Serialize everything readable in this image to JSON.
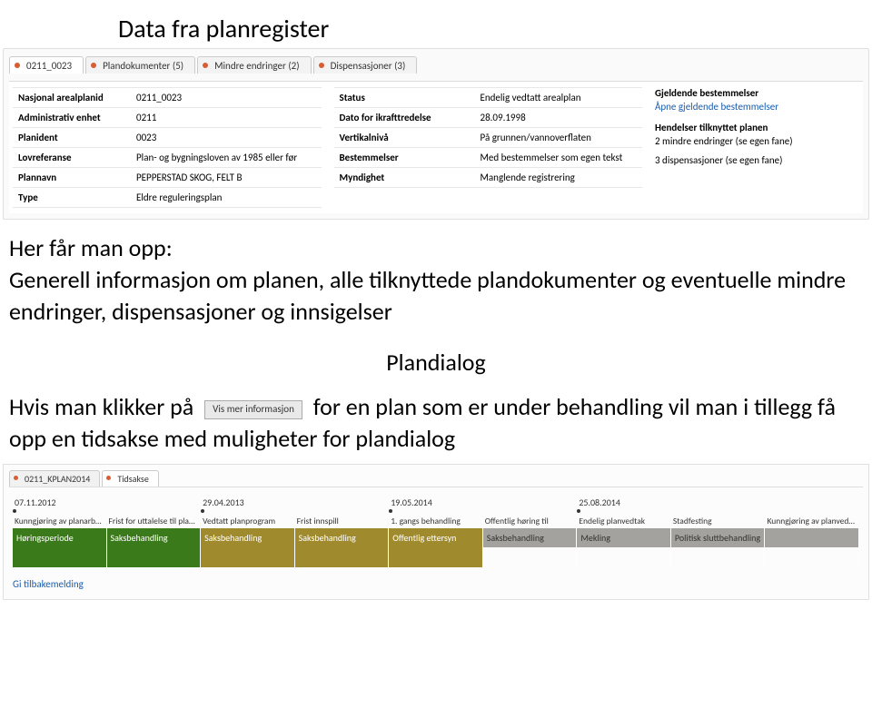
{
  "title": "Data fra planregister",
  "screenshot1": {
    "tabs": [
      {
        "label": "0211_0023",
        "active": true
      },
      {
        "label": "Plandokumenter (5)",
        "active": false
      },
      {
        "label": "Mindre endringer (2)",
        "active": false
      },
      {
        "label": "Dispensasjoner (3)",
        "active": false
      }
    ],
    "col1": [
      {
        "label": "Nasjonal arealplanid",
        "value": "0211_0023"
      },
      {
        "label": "Administrativ enhet",
        "value": "0211"
      },
      {
        "label": "Planident",
        "value": "0023"
      },
      {
        "label": "Lovreferanse",
        "value": "Plan- og bygningsloven av 1985 eller før"
      },
      {
        "label": "Plannavn",
        "value": "PEPPERSTAD SKOG, FELT B"
      },
      {
        "label": "Type",
        "value": "Eldre reguleringsplan"
      }
    ],
    "col2": [
      {
        "label": "Status",
        "value": "Endelig vedtatt arealplan"
      },
      {
        "label": "Dato for ikrafttredelse",
        "value": "28.09.1998"
      },
      {
        "label": "Vertikalnivå",
        "value": "På grunnen/vannoverflaten"
      },
      {
        "label": "Bestemmelser",
        "value": "Med bestemmelser som egen tekst"
      },
      {
        "label": "Myndighet",
        "value": "Manglende registrering"
      }
    ],
    "right": {
      "block1_title": "Gjeldende bestemmelser",
      "block1_link": "Åpne gjeldende bestemmelser",
      "block2_title": "Hendelser tilknyttet planen",
      "block2_line1": "2 mindre endringer (se egen fane)",
      "block2_line2": "3 dispensasjoner (se egen fane)"
    }
  },
  "body": {
    "line1": "Her får man opp:",
    "line2": "Generell informasjon om planen, alle tilknyttede plandokumenter og eventuelle mindre endringer, dispensasjoner og innsigelser",
    "subtitle": "Plandialog",
    "line3a": "Hvis man klikker på",
    "button_label": "Vis mer informasjon",
    "line3b": "for en plan som er under behandling vil man i tillegg få opp en tidsakse med muligheter for plandialog"
  },
  "screenshot2": {
    "tabs": [
      {
        "label": "0211_KPLAN2014",
        "active": false
      },
      {
        "label": "Tidsakse",
        "active": true
      }
    ],
    "dates": [
      "07.11.2012",
      "",
      "29.04.2013",
      "",
      "19.05.2014",
      "",
      "25.08.2014",
      "",
      ""
    ],
    "stages": [
      "Kunngjøring av planarbeid",
      "Frist for uttalelse til planprogram",
      "Vedtatt planprogram",
      "Frist innspill",
      "1. gangs behandling",
      "Offentlig høring til",
      "Endelig planvedtak",
      "Stadfesting",
      "Kunngjøring av planvedtak"
    ],
    "phases": [
      {
        "label": "Høringsperiode",
        "color": "green"
      },
      {
        "label": "Saksbehandling",
        "color": "green"
      },
      {
        "label": "Saksbehandling",
        "color": "olive"
      },
      {
        "label": "Saksbehandling",
        "color": "olive"
      },
      {
        "label": "Offentlig ettersyn",
        "color": "olive"
      },
      {
        "label": "Saksbehandling",
        "color": "gray"
      },
      {
        "label": "Mekling",
        "color": "gray"
      },
      {
        "label": "Politisk sluttbehandling",
        "color": "gray"
      },
      {
        "label": "",
        "color": "gray"
      }
    ],
    "bars": [
      "green",
      "green",
      "olive",
      "olive",
      "olive",
      "none",
      "none",
      "none",
      "none"
    ],
    "feedback": "Gi tilbakemelding"
  }
}
